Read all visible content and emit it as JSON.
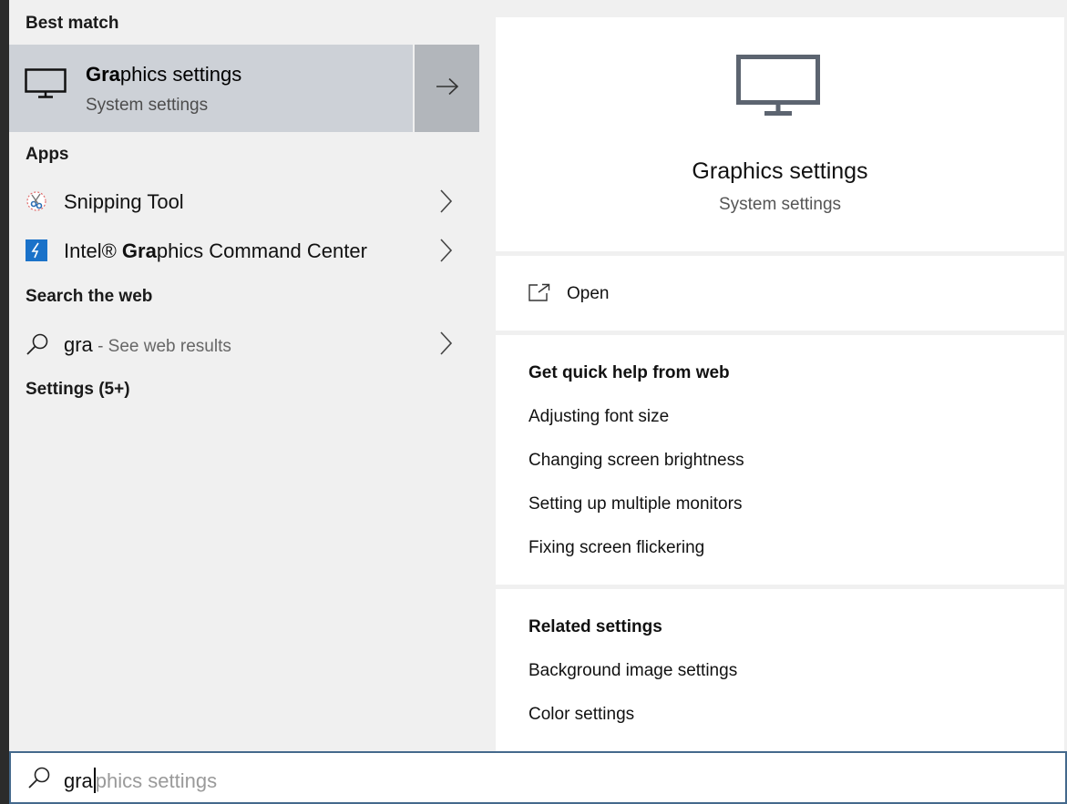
{
  "left": {
    "best_match_header": "Best match",
    "best_match": {
      "title_bold": "Gra",
      "title_rest": "phics settings",
      "subtitle": "System settings",
      "icon": "monitor-icon"
    },
    "apps_header": "Apps",
    "apps": [
      {
        "pre": "",
        "bold": "",
        "rest": "Snipping Tool",
        "icon": "snipping-tool-icon"
      },
      {
        "pre": "Intel® ",
        "bold": "Gra",
        "rest": "phics Command Center",
        "icon": "intel-graphics-icon"
      }
    ],
    "web_header": "Search the web",
    "web_result": {
      "query": "gra",
      "suffix": " - See web results",
      "icon": "search-icon"
    },
    "settings_header": "Settings (5+)"
  },
  "right": {
    "title": "Graphics settings",
    "subtitle": "System settings",
    "open_label": "Open",
    "quick_help_header": "Get quick help from web",
    "quick_help_links": [
      "Adjusting font size",
      "Changing screen brightness",
      "Setting up multiple monitors",
      "Fixing screen flickering"
    ],
    "related_header": "Related settings",
    "related_links": [
      "Background image settings",
      "Color settings"
    ]
  },
  "search": {
    "typed": "gra",
    "suggestion": "phics settings"
  },
  "colors": {
    "accent_border": "#44698c",
    "selected_bg": "#cdd1d7",
    "intel_blue": "#1a72c9"
  }
}
